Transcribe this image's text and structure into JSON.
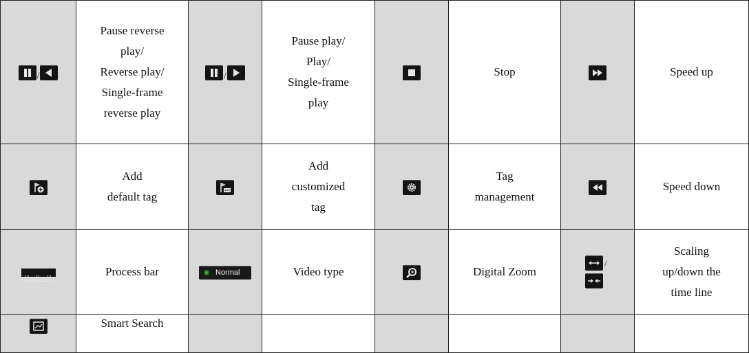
{
  "rows": [
    [
      {
        "icon": "pause-reverse-icon",
        "label": "Pause reverse\nplay/\nReverse play/\nSingle-frame\nreverse play"
      },
      {
        "icon": "pause-play-icon",
        "label": "Pause play/\nPlay/\nSingle-frame\nplay"
      },
      {
        "icon": "stop-icon",
        "label": "Stop"
      },
      {
        "icon": "speed-up-icon",
        "label": "Speed up"
      }
    ],
    [
      {
        "icon": "add-default-tag-icon",
        "label": "Add\ndefault tag"
      },
      {
        "icon": "add-customized-tag-icon",
        "label": "Add\ncustomized\ntag"
      },
      {
        "icon": "tag-management-icon",
        "label": "Tag\nmanagement"
      },
      {
        "icon": "speed-down-icon",
        "label": "Speed down"
      }
    ],
    [
      {
        "icon": "process-bar-icon",
        "label": "Process bar",
        "ticks": [
          "10",
          "11",
          "12"
        ]
      },
      {
        "icon": "video-type-badge",
        "label": "Video type",
        "badge": "Normal"
      },
      {
        "icon": "digital-zoom-icon",
        "label": "Digital Zoom"
      },
      {
        "icon": "timeline-scale-icon",
        "label": "Scaling\nup/down the\ntime line"
      }
    ],
    [
      {
        "icon": "smart-search-icon",
        "label": "Smart Search"
      },
      {
        "icon": "",
        "label": ""
      },
      {
        "icon": "",
        "label": ""
      },
      {
        "icon": "",
        "label": ""
      }
    ]
  ],
  "separator": "/",
  "colors": {
    "icon_bg": "#141414",
    "icon_cell_bg": "#d9d9d9",
    "badge_dot": "#3fae3f"
  }
}
